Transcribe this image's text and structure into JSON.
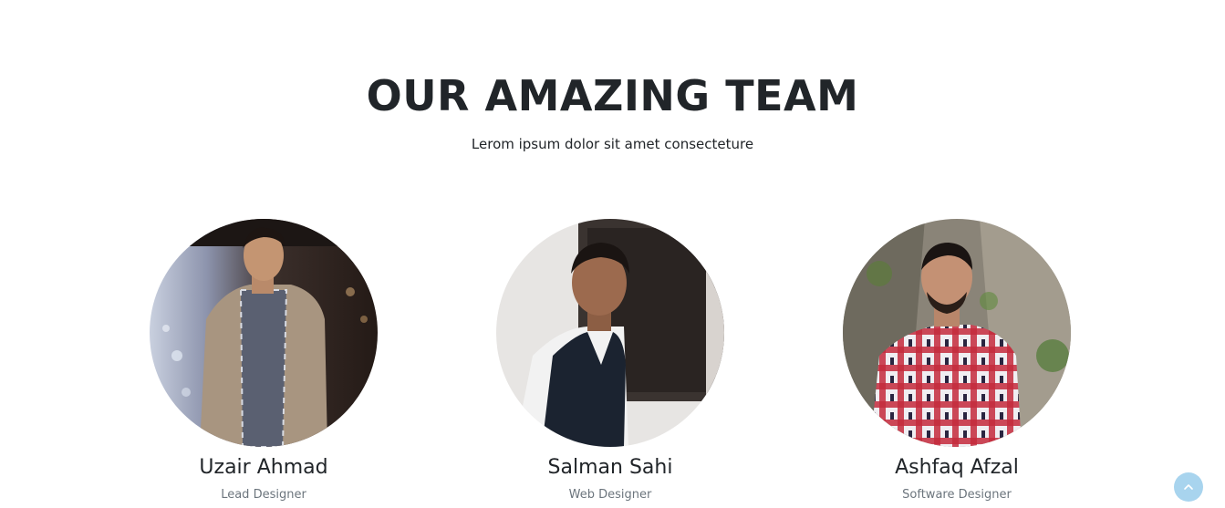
{
  "section": {
    "title": "OUR AMAZING TEAM",
    "subtitle": "Lerom ipsum dolor sit amet consecteture"
  },
  "team": [
    {
      "name": "Uzair Ahmad",
      "role": "Lead Designer"
    },
    {
      "name": "Salman Sahi",
      "role": "Web Designer"
    },
    {
      "name": "Ashfaq Afzal",
      "role": "Software Designer"
    }
  ],
  "scroll_top": {
    "icon": "chevron-up-icon",
    "color": "#a8d4ee"
  }
}
